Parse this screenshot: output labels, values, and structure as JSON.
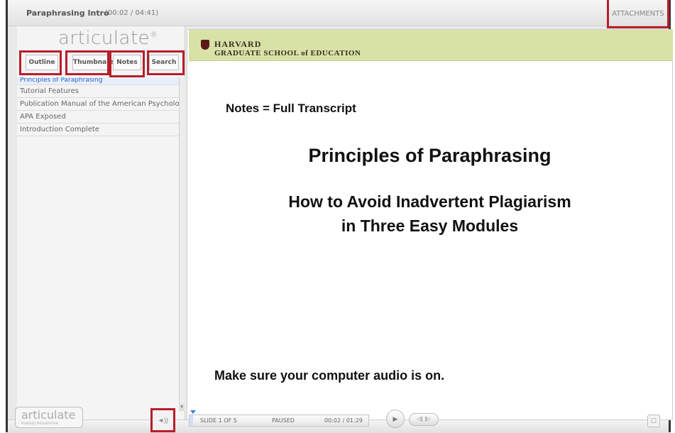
{
  "header": {
    "title": "Paraphrasing Intro",
    "time": "(00:02 / 04:41)",
    "attachments_label": "ATTACHMENTS"
  },
  "sidebar": {
    "logo_text": "articulate",
    "tabs": [
      {
        "label": "Outline"
      },
      {
        "label": "Thumbnails"
      },
      {
        "label": "Notes"
      },
      {
        "label": "Search"
      }
    ],
    "outline_items": [
      {
        "label": "Principles of Paraphrasing"
      },
      {
        "label": "Tutorial Features"
      },
      {
        "label": "Publication Manual of the American Psycholo"
      },
      {
        "label": "APA Exposed"
      },
      {
        "label": "Introduction Complete"
      }
    ]
  },
  "slide": {
    "banner_line1": "HARVARD",
    "banner_line2": "GRADUATE SCHOOL of EDUCATION",
    "notes_line": "Notes = Full Transcript",
    "title": "Principles of Paraphrasing",
    "subtitle_line1": "How to Avoid Inadvertent Plagiarism",
    "subtitle_line2": "in Three Easy Modules",
    "audio_note": "Make sure your computer audio is on."
  },
  "player": {
    "footer_logo": "articulate",
    "footer_sub": "POWERED PRESENTATION",
    "volume_icon": "speaker-icon",
    "slide_counter": "SLIDE 1 OF 5",
    "status": "PAUSED",
    "slide_time": "00:02 / 01:29",
    "progress_fraction": 0.02,
    "play_icon": "▶",
    "nav_icons": "◁∥ ∥▷",
    "fullscreen_icon": "☐"
  },
  "colors": {
    "highlight": "#b81d2b",
    "banner": "#d8e2a6",
    "accent": "#2a63c9"
  }
}
